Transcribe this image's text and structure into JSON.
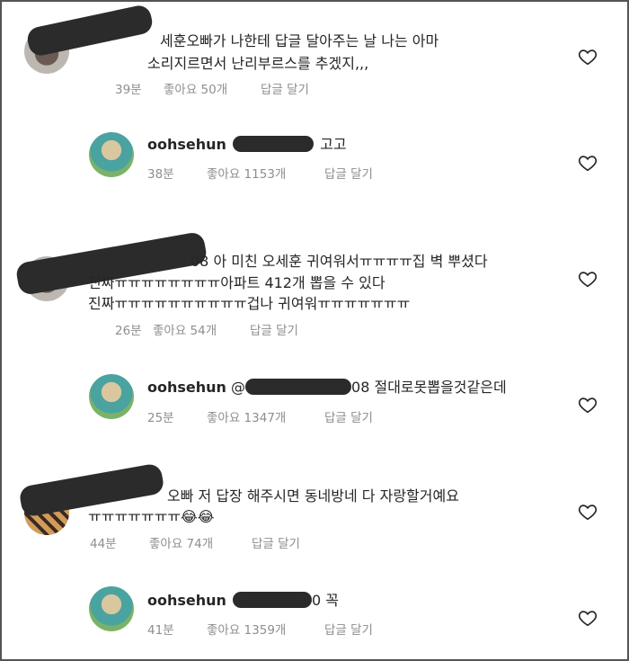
{
  "comments": [
    {
      "kind": "comment",
      "lines": [
        "세훈오빠가 나한테 답글 달아주는 날 나는 아마",
        "소리지르면서 난리부르스를 추겠지,,,"
      ],
      "time": "39분",
      "likes": "좋아요 50개",
      "reply": "답글 달기"
    },
    {
      "kind": "reply",
      "username": "oohsehun",
      "body": "고고",
      "time": "38분",
      "likes": "좋아요 1153개",
      "reply": "답글 달기"
    },
    {
      "kind": "comment",
      "lines": [
        "08 아 미친 오세훈 귀여워서ㅠㅠㅠㅠ집 벽 뿌셨다",
        "진짜ㅠㅠㅠㅠㅠㅠㅠㅠ아파트 412개 뽑을 수 있다",
        "진짜ㅠㅠㅠㅠㅠㅠㅠㅠㅠㅠ겁나 귀여워ㅠㅠㅠㅠㅠㅠㅠ"
      ],
      "time": "26분",
      "likes": "좋아요 54개",
      "reply": "답글 달기"
    },
    {
      "kind": "reply",
      "username": "oohsehun",
      "mention_prefix": "@",
      "mention_suffix": "08",
      "body": "절대로못뽑을것같은데",
      "time": "25분",
      "likes": "좋아요 1347개",
      "reply": "답글 달기"
    },
    {
      "kind": "comment",
      "lines": [
        "오빠 저 답장 해주시면 동네방네 다 자랑할거예요",
        "ㅠㅠㅠㅠㅠㅠㅠ😂😂"
      ],
      "time": "44분",
      "likes": "좋아요 74개",
      "reply": "답글 달기"
    },
    {
      "kind": "reply",
      "username": "oohsehun",
      "mention_suffix": "0",
      "body": "꼭",
      "time": "41분",
      "likes": "좋아요 1359개",
      "reply": "답글 달기"
    }
  ],
  "icons": {
    "like": "heart-outline-icon"
  },
  "colors": {
    "text": "#262626",
    "meta": "#8e8e8e",
    "redaction": "#2b2b2b"
  }
}
